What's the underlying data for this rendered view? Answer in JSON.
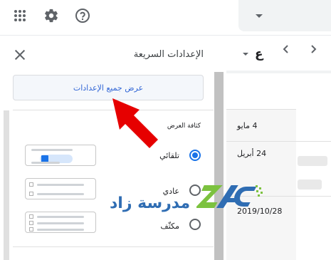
{
  "topbar": {
    "apps_icon": "apps-grid-icon",
    "settings_icon": "gear-icon",
    "help_icon": "help-icon"
  },
  "panel": {
    "title": "الإعدادات السريعة",
    "show_all_label": "عرض جميع الإعدادات",
    "density": {
      "title": "كثافة العرض",
      "options": [
        {
          "label": "تلقائي",
          "selected": true
        },
        {
          "label": "عادي",
          "selected": false
        },
        {
          "label": "مكثّف",
          "selected": false
        }
      ]
    }
  },
  "nav": {
    "label": "ع"
  },
  "calendar": {
    "dates": [
      "4 مايو",
      "24 أبريل",
      "2019/10/28"
    ]
  },
  "watermark": {
    "text": "مدرسة زاد"
  },
  "colors": {
    "accent": "#1a73e8",
    "arrow": "#e60000"
  }
}
